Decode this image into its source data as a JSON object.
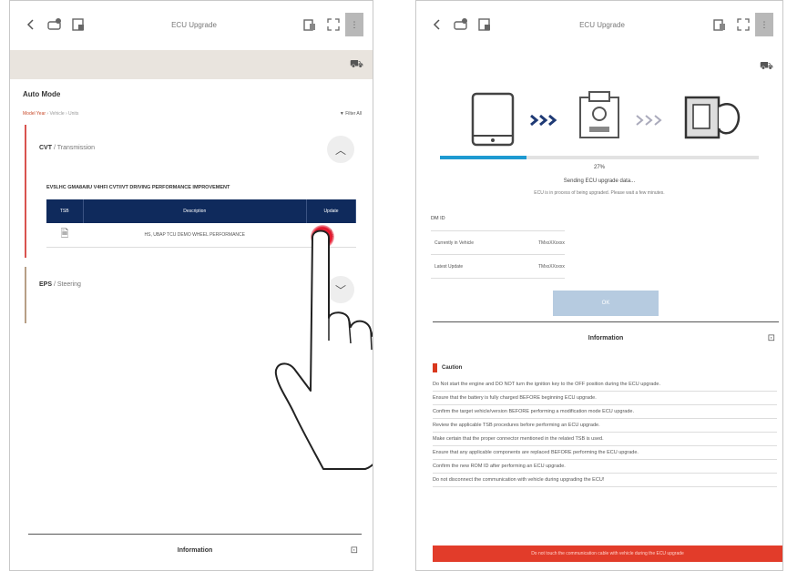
{
  "colors": {
    "accent_red": "#d9534f",
    "table_header": "#0f2a5c",
    "progress": "#1e9ad1",
    "warning": "#e23c2a",
    "touch": "#e0142a"
  },
  "left": {
    "topbar": {
      "back_icon": "chevron-left-icon",
      "title": "ECU Upgrade"
    },
    "mode_title": "Auto Mode",
    "breadcrumb": {
      "active": "Model Year",
      "rest": "› Vehicle › Units"
    },
    "filter_link": "▼ Filter All",
    "cvt": {
      "name": "CVT",
      "sub": "/ Transmission",
      "program_title": "EV5LHC GMA8A8U V4HFI CVT/IVT DRIVING PERFORMANCE IMPROVEMENT",
      "table": {
        "headers": [
          "TSB",
          "Description",
          "Update"
        ],
        "rows": [
          {
            "description": "HS, UBAP TCU DEMO WHEEL PERFORMANCE"
          }
        ]
      }
    },
    "eps": {
      "name": "EPS",
      "sub": "/ Steering"
    },
    "info_label": "Information"
  },
  "right": {
    "topbar": {
      "title": "ECU Upgrade"
    },
    "progress": {
      "percent": 27,
      "label": "27%"
    },
    "status": "Sending ECU upgrade data...",
    "status_sub": "ECU is in process of being upgraded. Please wait a few minutes.",
    "dm_label": "DM ID",
    "versions": [
      {
        "label": "Currently in Vehicle",
        "value": "TMxxXXxxxx"
      },
      {
        "label": "Latest Update",
        "value": "TMxxXXxxxx"
      }
    ],
    "ok_label": "OK",
    "info_label": "Information",
    "caution": {
      "title": "Caution",
      "items": [
        "Do Not start the engine and DO NOT turn the ignition key to the OFF position during the ECU upgrade.",
        "Ensure that the battery is fully charged BEFORE beginning ECU upgrade.",
        "Confirm the target vehicle/version BEFORE performing a modification mode ECU upgrade.",
        "Review the applicable TSB procedures before performing an ECU upgrade.",
        "Make certain that the proper connector mentioned in the related TSB is used.",
        "Ensure that any applicable components are replaced BEFORE performing the ECU upgrade.",
        "Confirm the new ROM ID after performing an ECU upgrade.",
        "Do not disconnect the communication with vehicle during upgrading the ECU!"
      ]
    },
    "warning_bar": "Do not touch the communication cable with vehicle during the ECU upgrade"
  }
}
